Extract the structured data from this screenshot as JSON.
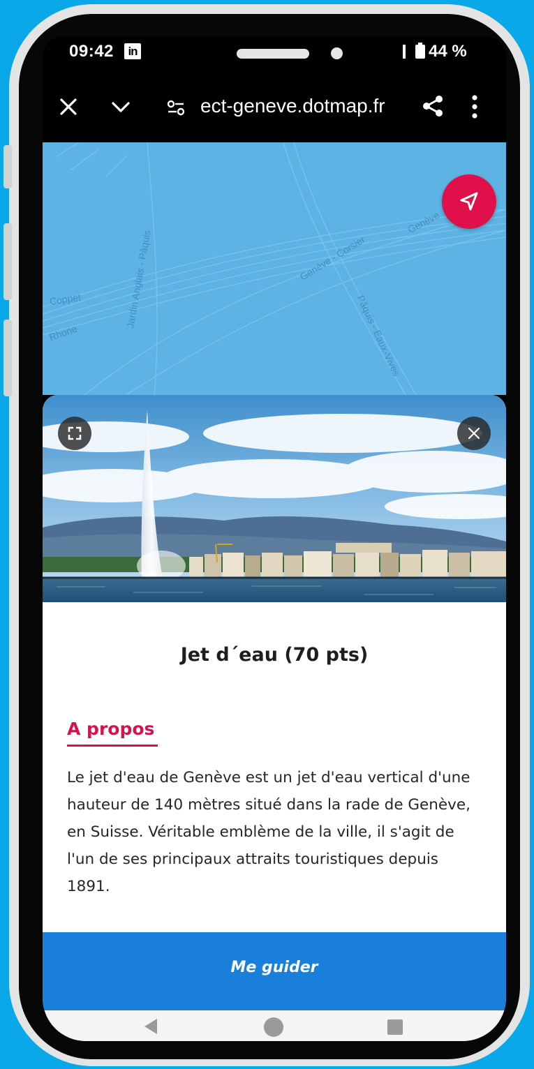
{
  "status_bar": {
    "time": "09:42",
    "app_icon": "linkedin-icon",
    "app_icon_text": "in",
    "battery_percent": "44 %"
  },
  "browser": {
    "url": "ect-geneve.dotmap.fr",
    "icons": [
      "close-icon",
      "chevron-down-icon",
      "tune-icon",
      "share-icon",
      "more-vert-icon"
    ]
  },
  "map": {
    "labels": [
      "Coppet",
      "Rhone",
      "Jardin Anglais - Pâquis",
      "Genève - Corsier",
      "Pâquis - Eaux-Vives",
      "Genève"
    ],
    "fab_icon": "navigation-arrow-icon",
    "colors": {
      "water": "#5db4e4",
      "fab": "#e0104a"
    }
  },
  "poi": {
    "title": "Jet d´eau (70 pts)",
    "section_heading": "A propos",
    "description": "Le jet d'eau de Genève est un jet d'eau vertical d'une hauteur de 140 mètres situé dans la rade de Genève, en Suisse. Véritable emblème de la ville, il s'agit de l'un de ses principaux attraits touristiques depuis 1891.",
    "photo_icons": [
      "fullscreen-icon",
      "close-icon"
    ],
    "action_label": "Me guider",
    "colors": {
      "accent": "#d21350",
      "button": "#1a7fdb"
    }
  },
  "system_nav": {
    "icons": [
      "back-icon",
      "home-icon",
      "recents-icon"
    ]
  }
}
